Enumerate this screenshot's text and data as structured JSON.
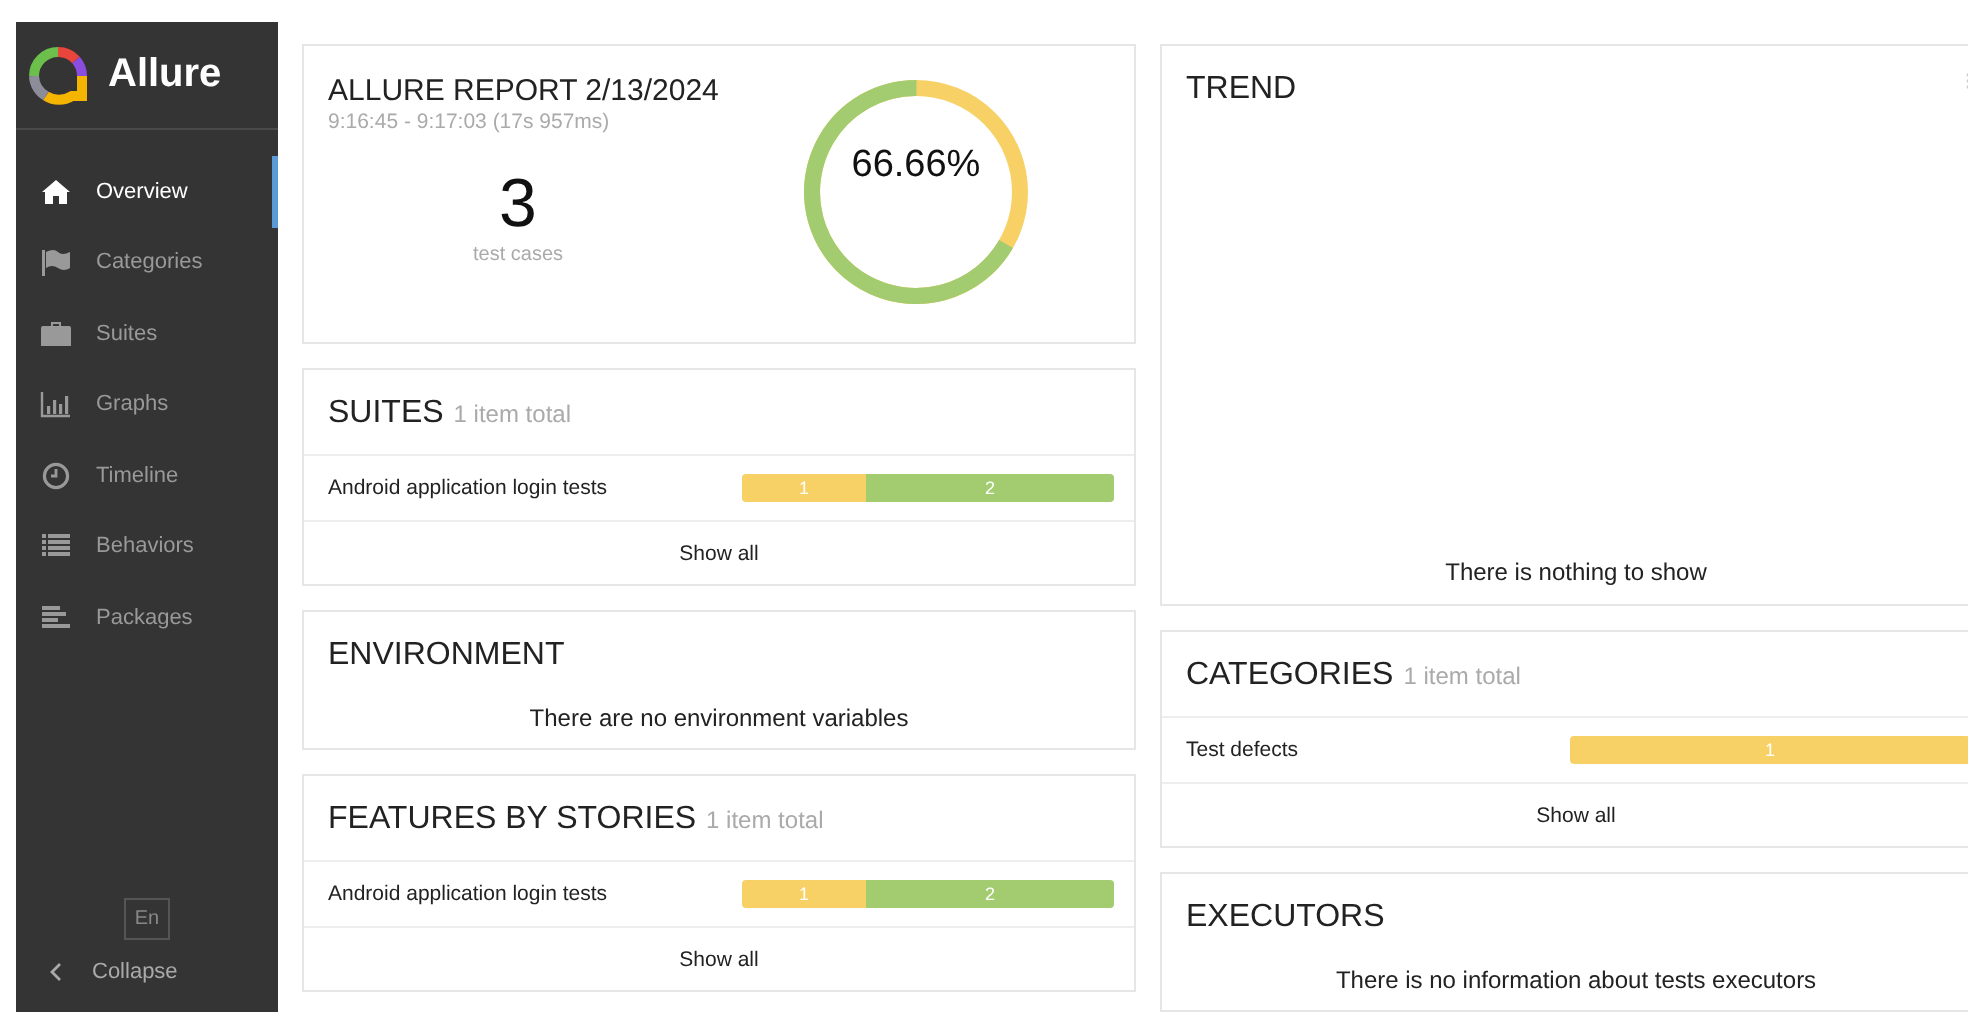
{
  "sidebar": {
    "logo": "Allure",
    "items": [
      {
        "label": "Overview",
        "selected": true
      },
      {
        "label": "Categories",
        "selected": false
      },
      {
        "label": "Suites",
        "selected": false
      },
      {
        "label": "Graphs",
        "selected": false
      },
      {
        "label": "Timeline",
        "selected": false
      },
      {
        "label": "Behaviors",
        "selected": false
      },
      {
        "label": "Packages",
        "selected": false
      }
    ],
    "language": "En",
    "collapse": "Collapse"
  },
  "summary": {
    "title": "ALLURE REPORT 2/13/2024",
    "time": "9:16:45 - 9:17:03 (17s 957ms)",
    "count": "3",
    "count_label": "test cases",
    "donut": {
      "label": "66.66%",
      "level": 0.6666
    }
  },
  "left_widgets": [
    {
      "kind": "list",
      "title": "SUITES",
      "total": "1 item total",
      "rows": [
        {
          "name": "Android application login tests",
          "segments": [
            {
              "color": "#f8d166",
              "count": "1"
            },
            {
              "color": "#a2cc6f",
              "count": "2"
            }
          ]
        }
      ],
      "footer": "Show all"
    },
    {
      "kind": "empty",
      "title": "ENVIRONMENT",
      "message": "There are no environment variables"
    },
    {
      "kind": "list",
      "title": "FEATURES BY STORIES",
      "total": "1 item total",
      "rows": [
        {
          "name": "Android application login tests",
          "segments": [
            {
              "color": "#f8d166",
              "count": "1"
            },
            {
              "color": "#a2cc6f",
              "count": "2"
            }
          ]
        }
      ],
      "footer": "Show all"
    }
  ],
  "right_widgets": [
    {
      "kind": "trend",
      "title": "TREND",
      "message": "There is nothing to show"
    },
    {
      "kind": "list",
      "title": "CATEGORIES",
      "total": "1 item total",
      "rows": [
        {
          "name": "Test defects",
          "segments": [
            {
              "color": "#f8d166",
              "count": "1"
            }
          ]
        }
      ],
      "footer": "Show all"
    },
    {
      "kind": "empty",
      "title": "EXECUTORS",
      "message": "There is no information about tests executors"
    }
  ]
}
